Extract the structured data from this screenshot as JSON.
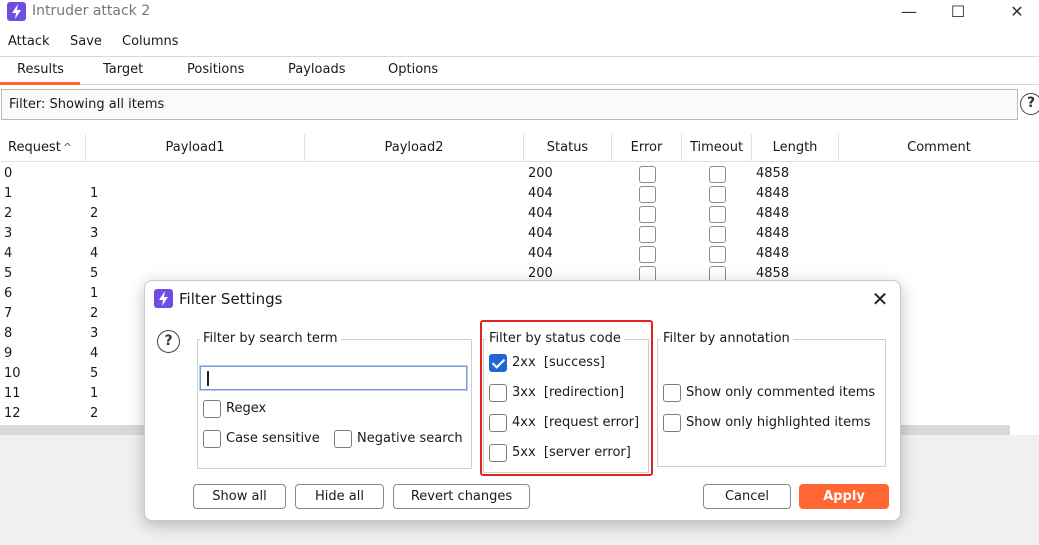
{
  "window": {
    "title": "Intruder attack 2",
    "controls": [
      "—",
      "☐",
      "✕"
    ]
  },
  "menu": [
    "Attack",
    "Save",
    "Columns"
  ],
  "tabs": [
    "Results",
    "Target",
    "Positions",
    "Payloads",
    "Options"
  ],
  "active_tab": "Results",
  "filter_bar": {
    "text": "Filter: Showing all items",
    "help": "?"
  },
  "table": {
    "columns": [
      "Request",
      "Payload1",
      "Payload2",
      "Status",
      "Error",
      "Timeout",
      "Length",
      "Comment"
    ],
    "sort_indicator": "^",
    "rows": [
      {
        "request": "0",
        "payload1": "",
        "status": "200",
        "length": "4858"
      },
      {
        "request": "1",
        "payload1": "1",
        "status": "404",
        "length": "4848"
      },
      {
        "request": "2",
        "payload1": "2",
        "status": "404",
        "length": "4848"
      },
      {
        "request": "3",
        "payload1": "3",
        "status": "404",
        "length": "4848"
      },
      {
        "request": "4",
        "payload1": "4",
        "status": "404",
        "length": "4848"
      },
      {
        "request": "5",
        "payload1": "5",
        "status": "200",
        "length": "4858"
      },
      {
        "request": "6",
        "payload1": "1",
        "status": "",
        "length": ""
      },
      {
        "request": "7",
        "payload1": "2",
        "status": "",
        "length": ""
      },
      {
        "request": "8",
        "payload1": "3",
        "status": "",
        "length": ""
      },
      {
        "request": "9",
        "payload1": "4",
        "status": "",
        "length": ""
      },
      {
        "request": "10",
        "payload1": "5",
        "status": "",
        "length": ""
      },
      {
        "request": "11",
        "payload1": "1",
        "status": "",
        "length": ""
      },
      {
        "request": "12",
        "payload1": "2",
        "status": "",
        "length": ""
      }
    ]
  },
  "dialog": {
    "title": "Filter Settings",
    "close": "✕",
    "help": "?",
    "search_group": {
      "title": "Filter by search term",
      "input_value": "",
      "regex": {
        "label": "Regex",
        "checked": false
      },
      "case_sensitive": {
        "label": "Case sensitive",
        "checked": false
      },
      "negative_search": {
        "label": "Negative search",
        "checked": false
      }
    },
    "status_group": {
      "title": "Filter by status code",
      "options": [
        {
          "label": "2xx  [success]",
          "checked": true
        },
        {
          "label": "3xx  [redirection]",
          "checked": false
        },
        {
          "label": "4xx  [request error]",
          "checked": false
        },
        {
          "label": "5xx  [server error]",
          "checked": false
        }
      ]
    },
    "annotation_group": {
      "title": "Filter by annotation",
      "options": [
        {
          "label": "Show only commented items",
          "checked": false
        },
        {
          "label": "Show only highlighted items",
          "checked": false
        }
      ]
    },
    "buttons": {
      "show_all": "Show all",
      "hide_all": "Hide all",
      "revert": "Revert changes",
      "cancel": "Cancel",
      "apply": "Apply"
    }
  },
  "colors": {
    "accent": "#ff6633",
    "brand": "#6f4de0",
    "highlight": "#e52222",
    "check": "#2266d4"
  }
}
